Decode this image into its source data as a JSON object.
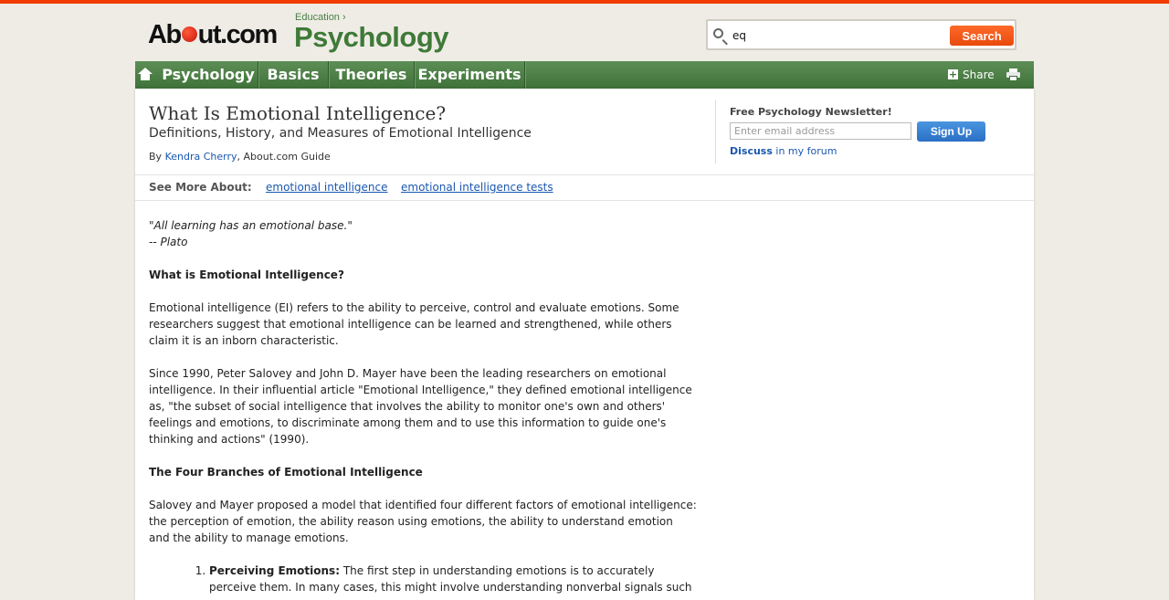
{
  "header": {
    "logo_about": "About.com",
    "education_link": "Education",
    "logo_site": "Psychology",
    "search": {
      "value": "eq",
      "button": "Search"
    }
  },
  "nav": {
    "items": [
      {
        "label": "Psychology"
      },
      {
        "label": "Basics"
      },
      {
        "label": "Theories"
      },
      {
        "label": "Experiments"
      }
    ],
    "share": "Share"
  },
  "article_header": {
    "title": "What Is Emotional Intelligence?",
    "subtitle": "Definitions, History, and Measures of Emotional Intelligence",
    "by": "By",
    "author": "Kendra Cherry",
    "author_role": ", About.com Guide"
  },
  "newsletter": {
    "title": "Free Psychology Newsletter!",
    "placeholder": "Enter email address",
    "button": "Sign Up",
    "discuss": "Discuss",
    "discuss_suffix": "in my forum"
  },
  "see_more": {
    "label": "See More About:",
    "links": [
      "emotional intelligence",
      "emotional intelligence tests"
    ]
  },
  "article": {
    "quote_line1": "\"All learning has an emotional base.\"",
    "quote_line2": "-- Plato",
    "heading1": "What is Emotional Intelligence?",
    "para1": "Emotional intelligence (EI) refers to the ability to perceive, control and evaluate emotions. Some researchers suggest that emotional intelligence can be learned and strengthened, while others claim it is an inborn characteristic.",
    "para2": "Since 1990, Peter Salovey and John D. Mayer have been the leading researchers on emotional intelligence. In their influential article \"Emotional Intelligence,\" they defined emotional intelligence as, \"the subset of social intelligence that involves the ability to monitor one's own and others' feelings and emotions, to discriminate among them and to use this information to guide one's thinking and actions\" (1990).",
    "heading2": "The Four Branches of Emotional Intelligence",
    "para3": "Salovey and Mayer proposed a model that identified four different factors of emotional intelligence: the perception of emotion, the ability reason using emotions, the ability to understand emotion and the ability to manage emotions.",
    "list_item1_title": "Perceiving Emotions:",
    "list_item1_text": " The first step in understanding emotions is to accurately perceive them. In many cases, this might involve understanding nonverbal signals such"
  },
  "colors": {
    "accent_orange": "#f03c00",
    "nav_green": "#3f7239",
    "link_blue": "#1a57b0"
  }
}
